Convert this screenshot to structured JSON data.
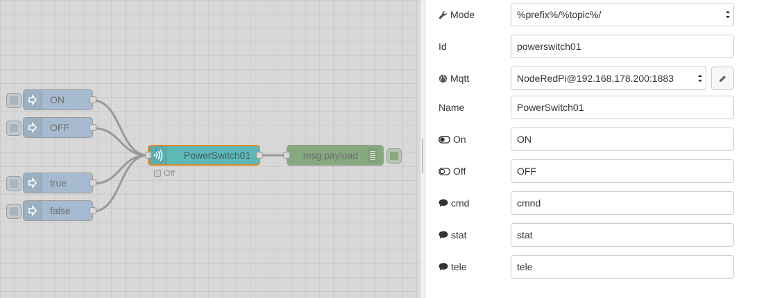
{
  "canvas": {
    "inject_nodes": [
      {
        "label": "ON"
      },
      {
        "label": "OFF"
      },
      {
        "label": "true"
      },
      {
        "label": "false"
      }
    ],
    "mqtt_node": {
      "label": "PowerSwitch01",
      "status": "Off"
    },
    "debug_node": {
      "label": "msg.payload"
    }
  },
  "panel": {
    "mode": {
      "label": "Mode",
      "value": "%prefix%/%topic%/",
      "icon": "wrench-icon"
    },
    "id": {
      "label": "Id",
      "value": "powerswitch01"
    },
    "mqtt": {
      "label": "Mqtt",
      "value": "NodeRedPi@192.168.178.200:1883",
      "icon": "globe-icon"
    },
    "name": {
      "label": "Name",
      "value": "PowerSwitch01"
    },
    "on": {
      "label": "On",
      "value": "ON",
      "icon": "toggle-on-icon"
    },
    "off": {
      "label": "Off",
      "value": "OFF",
      "icon": "toggle-off-icon"
    },
    "cmd": {
      "label": "cmd",
      "value": "cmnd",
      "icon": "comment-icon"
    },
    "stat": {
      "label": "stat",
      "value": "stat",
      "icon": "comment-icon"
    },
    "tele": {
      "label": "tele",
      "value": "tele",
      "icon": "comment-icon"
    }
  },
  "colors": {
    "canvas_bg": "#d8d8d8",
    "inject_node": "#a6bbcf",
    "mqtt_node": "#5fb8b8",
    "selected_border": "#e08a2c",
    "debug_node": "#87a980"
  }
}
